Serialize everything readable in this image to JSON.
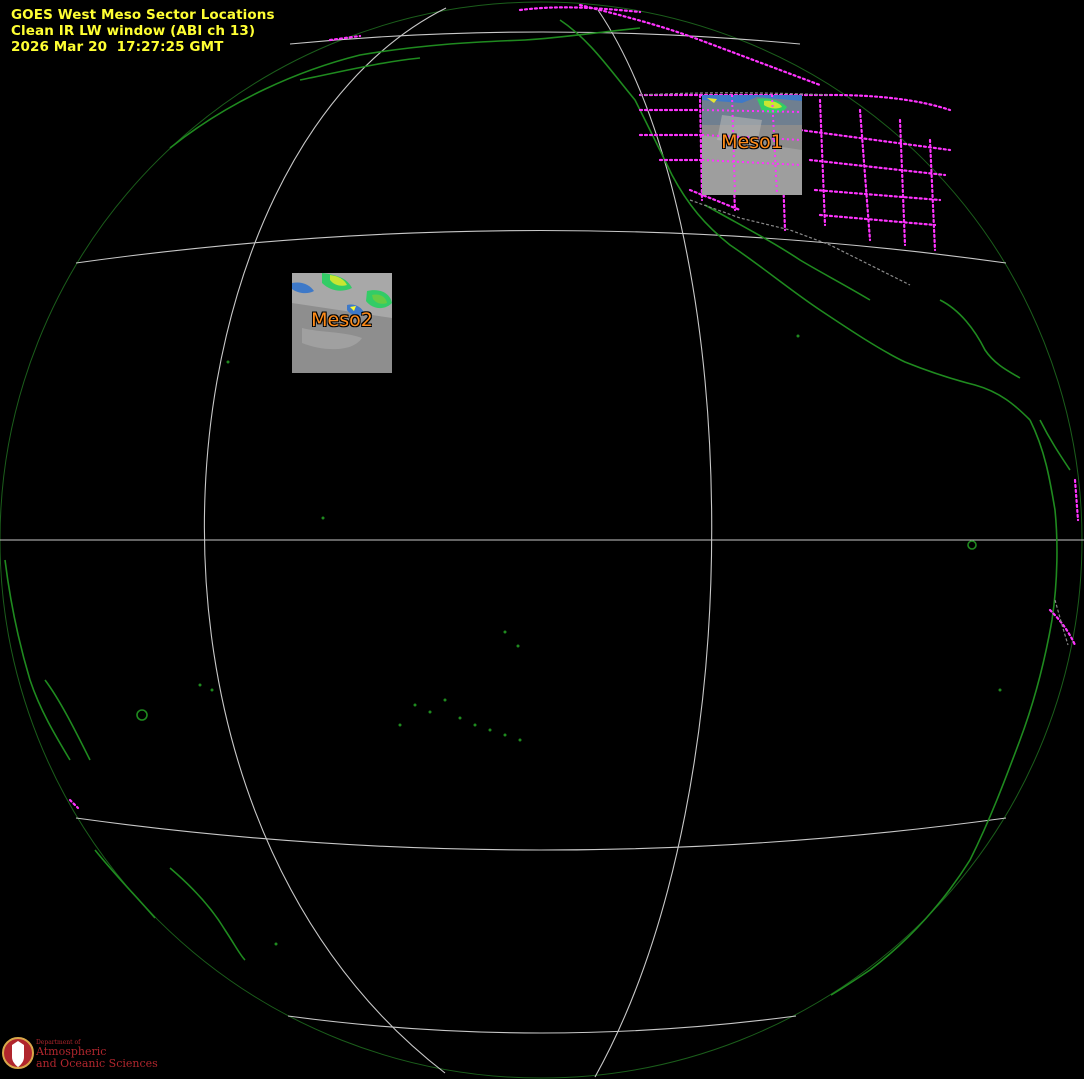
{
  "header": {
    "line1": "GOES West Meso Sector Locations",
    "line2": "Clean IR LW window (ABI ch 13)",
    "line3": "2026 Mar 20  17:27:25 GMT"
  },
  "sectors": {
    "meso1": {
      "label": "Meso1"
    },
    "meso2": {
      "label": "Meso2"
    }
  },
  "logo": {
    "department": "Department of",
    "name_line1": "Atmospheric",
    "name_line2": "and Oceanic Sciences",
    "seal_letter": "W"
  },
  "colors": {
    "background": "#000000",
    "title_text": "#ffff33",
    "graticule": "#c8c8c8",
    "coastline": "#1f8a1f",
    "political_boundaries": "#ff33ff",
    "sector_label": "#ff8c1a",
    "logo": "#b0262d"
  }
}
